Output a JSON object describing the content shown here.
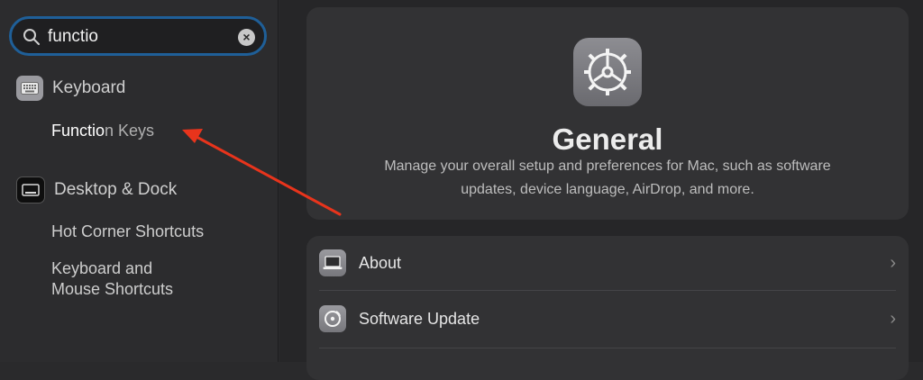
{
  "search": {
    "value": "functio"
  },
  "sidebar": {
    "groups": [
      {
        "label": "Keyboard",
        "results": [
          {
            "match": "Functio",
            "rest": "n Keys"
          }
        ]
      },
      {
        "label": "Desktop & Dock",
        "results": [
          "Hot Corner Shortcuts",
          "Keyboard and",
          "Mouse Shortcuts"
        ]
      }
    ]
  },
  "hero": {
    "title": "General",
    "description_line1": "Manage your overall setup and preferences for Mac, such as software",
    "description_line2": "updates, device language, AirDrop, and more."
  },
  "list": [
    {
      "label": "About"
    },
    {
      "label": "Software Update"
    }
  ],
  "colors": {
    "search_focus": "#1f5f98",
    "annotation_arrow": "#e8341c"
  }
}
